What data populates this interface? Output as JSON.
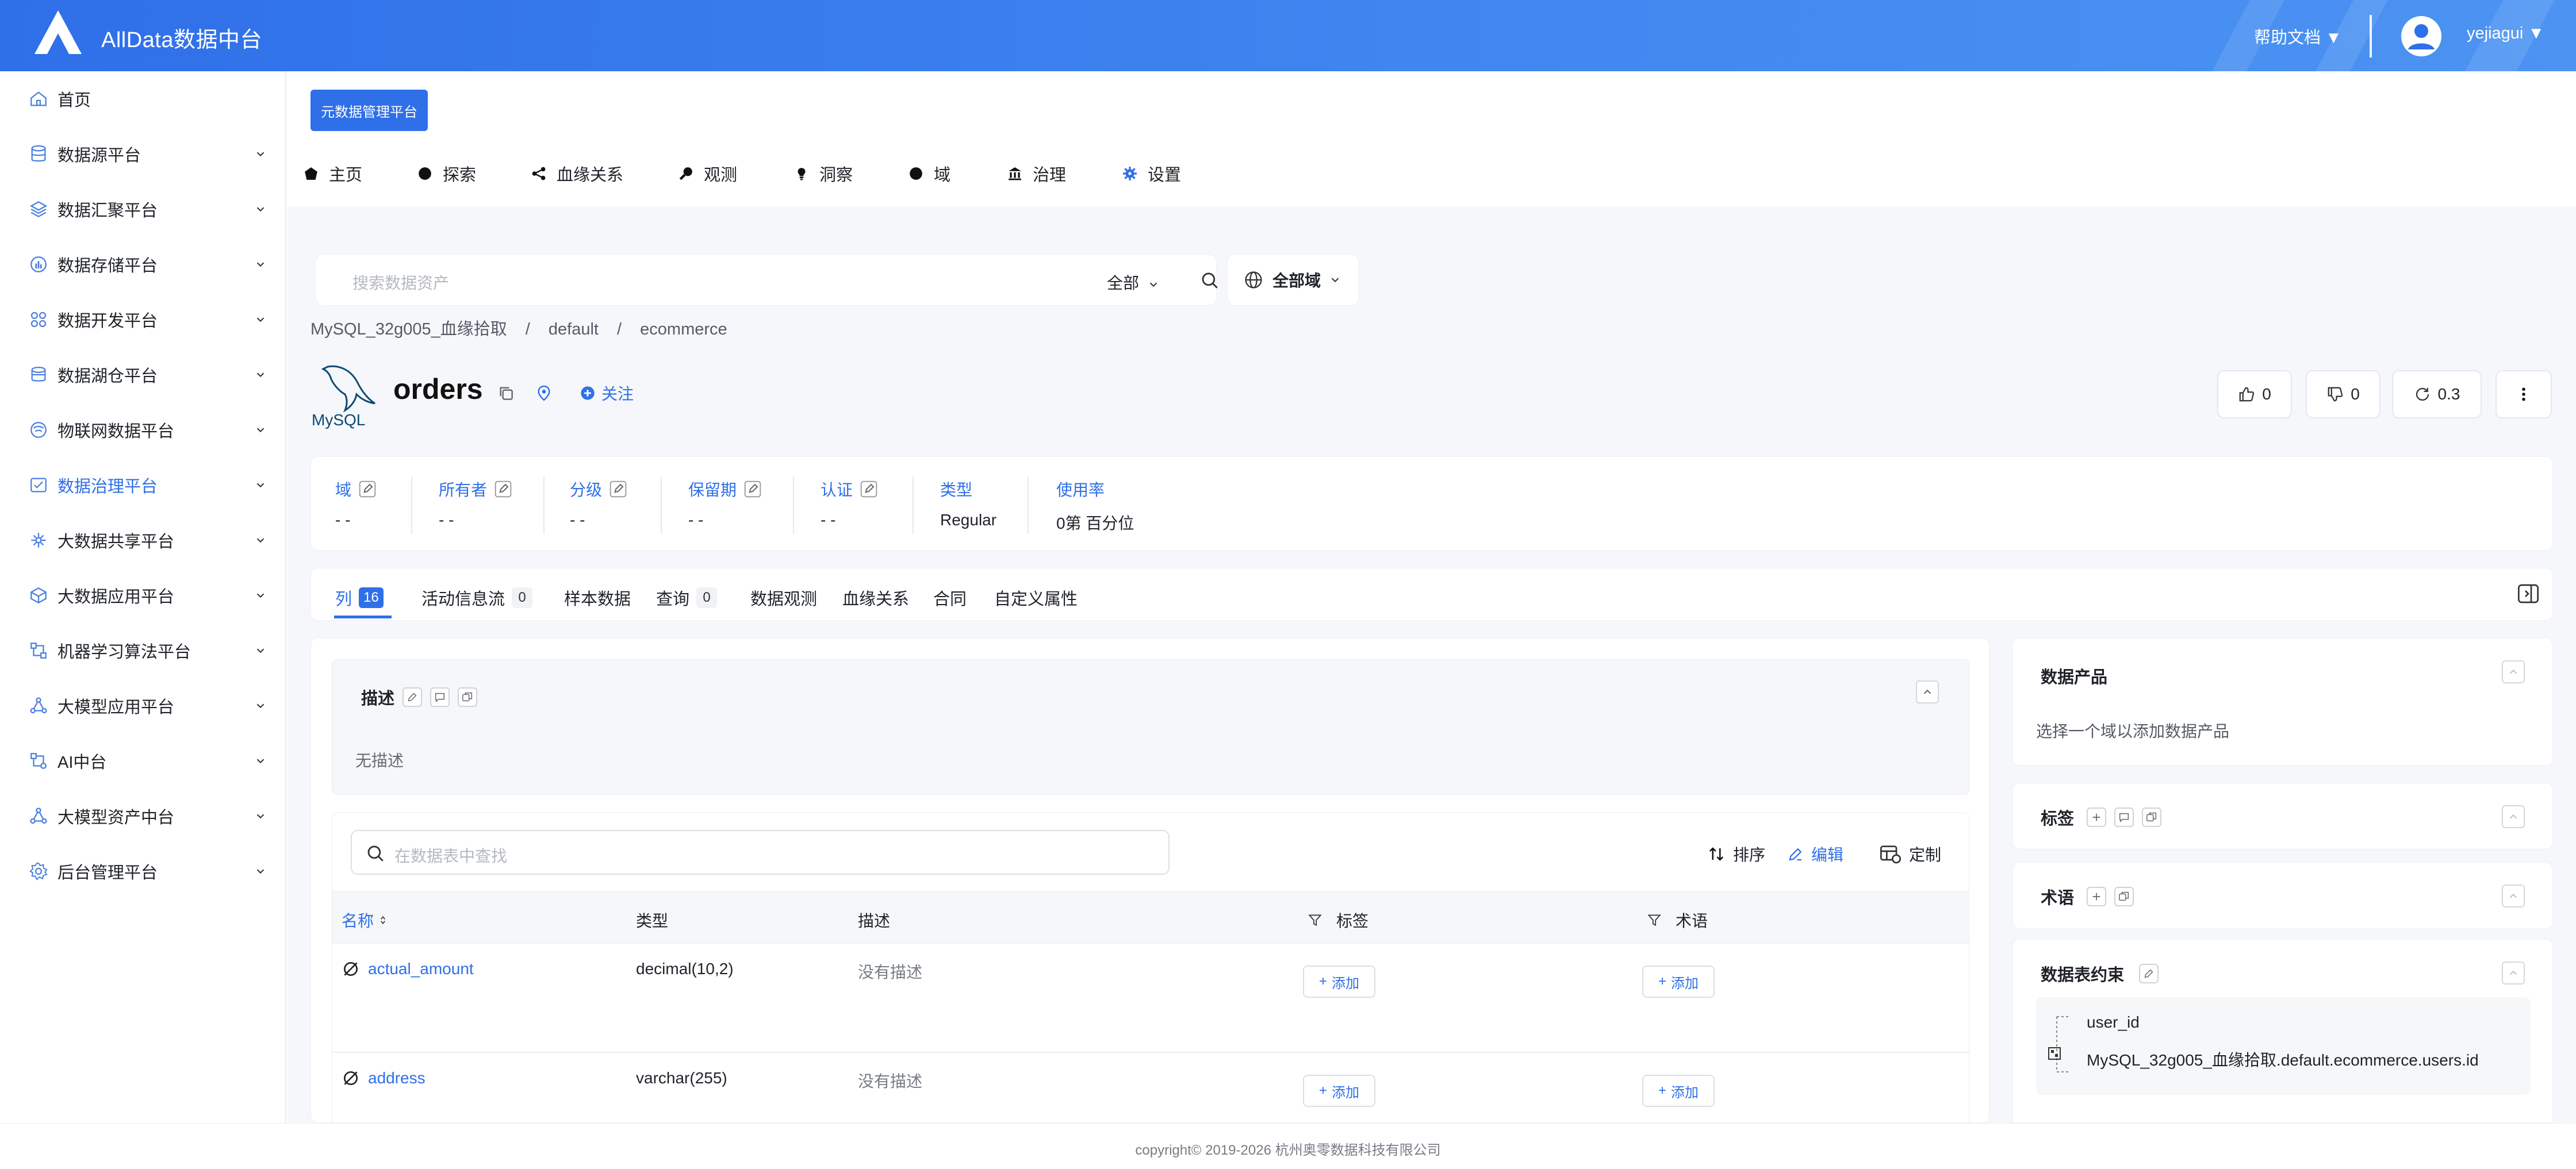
{
  "header": {
    "app_title": "AllData数据中台",
    "help_label": "帮助文档 ▼",
    "username": "yejiagui ▼"
  },
  "sidebar": {
    "items": [
      {
        "label": "首页",
        "icon": "home-icon",
        "expandable": false
      },
      {
        "label": "数据源平台",
        "icon": "database-icon",
        "expandable": true
      },
      {
        "label": "数据汇聚平台",
        "icon": "layers-icon",
        "expandable": true
      },
      {
        "label": "数据存储平台",
        "icon": "storage-chart-icon",
        "expandable": true
      },
      {
        "label": "数据开发平台",
        "icon": "grid-icon",
        "expandable": true
      },
      {
        "label": "数据湖仓平台",
        "icon": "lake-icon",
        "expandable": true
      },
      {
        "label": "物联网数据平台",
        "icon": "iot-icon",
        "expandable": true
      },
      {
        "label": "数据治理平台",
        "icon": "governance-icon",
        "expandable": true,
        "active": true
      },
      {
        "label": "大数据共享平台",
        "icon": "share-icon",
        "expandable": true
      },
      {
        "label": "大数据应用平台",
        "icon": "cube-icon",
        "expandable": true
      },
      {
        "label": "机器学习算法平台",
        "icon": "ml-icon",
        "expandable": true
      },
      {
        "label": "大模型应用平台",
        "icon": "model-app-icon",
        "expandable": true
      },
      {
        "label": "AI中台",
        "icon": "ai-icon",
        "expandable": true
      },
      {
        "label": "大模型资产中台",
        "icon": "model-asset-icon",
        "expandable": true
      },
      {
        "label": "后台管理平台",
        "icon": "settings-gear-icon",
        "expandable": true
      }
    ]
  },
  "meta_platform_button": "元数据管理平台",
  "top_nav": [
    {
      "label": "主页"
    },
    {
      "label": "探索"
    },
    {
      "label": "血缘关系"
    },
    {
      "label": "观测"
    },
    {
      "label": "洞察"
    },
    {
      "label": "域"
    },
    {
      "label": "治理"
    },
    {
      "label": "设置"
    }
  ],
  "search": {
    "placeholder": "搜索数据资产",
    "scope": "全部",
    "domain": "全部域"
  },
  "breadcrumb": [
    "MySQL_32g005_血缘拾取",
    "/",
    "default",
    "/",
    "ecommerce"
  ],
  "entity": {
    "name": "orders",
    "follow_label": "关注",
    "logo_text": "MySQL",
    "likes": "0",
    "dislikes": "0",
    "version": "0.3"
  },
  "properties": [
    {
      "label": "域",
      "value": "- -",
      "editable": true
    },
    {
      "label": "所有者",
      "value": "- -",
      "editable": true
    },
    {
      "label": "分级",
      "value": "- -",
      "editable": true
    },
    {
      "label": "保留期",
      "value": "- -",
      "editable": true
    },
    {
      "label": "认证",
      "value": "- -",
      "editable": true
    },
    {
      "label": "类型",
      "value": "Regular",
      "editable": false
    },
    {
      "label": "使用率",
      "value": "0第 百分位",
      "editable": false
    }
  ],
  "tabs": [
    {
      "label": "列",
      "badge": "16",
      "active": true
    },
    {
      "label": "活动信息流",
      "badge": "0"
    },
    {
      "label": "样本数据"
    },
    {
      "label": "查询",
      "badge": "0"
    },
    {
      "label": "数据观测"
    },
    {
      "label": "血缘关系"
    },
    {
      "label": "合同"
    },
    {
      "label": "自定义属性"
    }
  ],
  "description": {
    "title": "描述",
    "value": "无描述"
  },
  "columns_table": {
    "search_placeholder": "在数据表中查找",
    "sort_label": "排序",
    "edit_label": "编辑",
    "customize_label": "定制",
    "headers": {
      "name": "名称",
      "type": "类型",
      "description": "描述",
      "tags": "标签",
      "glossary": "术语"
    },
    "add_label": "添加",
    "rows": [
      {
        "name": "actual_amount",
        "type": "decimal(10,2)",
        "description": "没有描述"
      },
      {
        "name": "address",
        "type": "varchar(255)",
        "description": "没有描述"
      }
    ]
  },
  "right_panel": {
    "data_product_title": "数据产品",
    "data_product_hint": "选择一个域以添加数据产品",
    "tags_title": "标签",
    "glossary_title": "术语",
    "constraint_title": "数据表约束",
    "constraint_column": "user_id",
    "constraint_ref": "MySQL_32g005_血缘拾取.default.ecommerce.users.id"
  },
  "footer": "copyright© 2019-2026 杭州奥零数据科技有限公司",
  "colors": {
    "accent": "#2f6fe8",
    "header_start": "#2f6fe8",
    "header_end": "#4c93f2"
  }
}
